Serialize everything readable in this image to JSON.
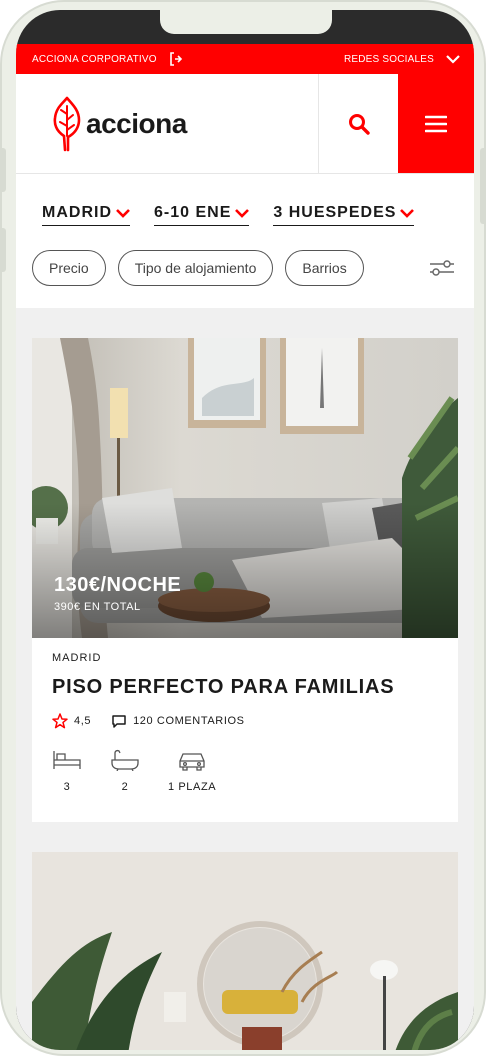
{
  "topbar": {
    "corporate_label": "ACCIONA CORPORATIVO",
    "social_label": "REDES SOCIALES"
  },
  "header": {
    "logo_text": "acciona"
  },
  "filters": {
    "dropdowns": [
      "MADRID",
      "6-10 ENE",
      "3 HUESPEDES"
    ],
    "chips": [
      "Precio",
      "Tipo de alojamiento",
      "Barrios"
    ]
  },
  "listings": [
    {
      "price": "130€/NOCHE",
      "total": "390€ EN TOTAL",
      "city": "MADRID",
      "title": "PISO PERFECTO PARA FAMILIAS",
      "rating": "4,5",
      "comments": "120 COMENTARIOS",
      "beds": "3",
      "baths": "2",
      "parking": "1 PLAZA"
    }
  ],
  "colors": {
    "brand_red": "#ff0000"
  }
}
